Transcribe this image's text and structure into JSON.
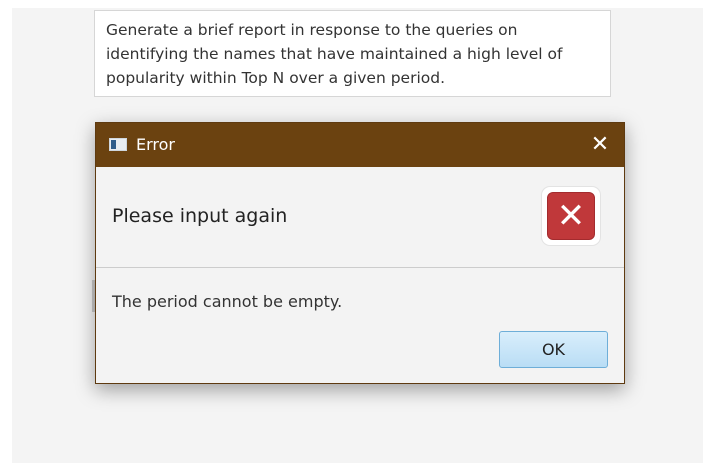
{
  "page": {
    "description": "Generate a brief report in response to the queries on identifying the names that have maintained a high level of popularity within Top N over a given period."
  },
  "dialog": {
    "title": "Error",
    "close_glyph": "✕",
    "header_text": "Please input again",
    "error_icon_glyph": "✕",
    "content_text": "The period cannot be empty.",
    "ok_label": "OK"
  },
  "colors": {
    "title_bar": "#6b4210",
    "error_icon": "#c0383a",
    "ok_button": "#b9ddf5"
  },
  "icons": {
    "window": "window-icon",
    "close": "close-icon",
    "error": "error-icon"
  }
}
